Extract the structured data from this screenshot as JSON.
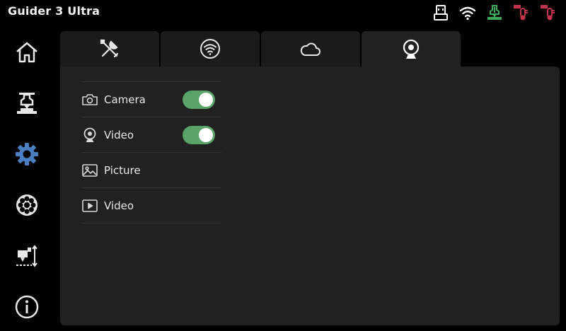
{
  "app": {
    "title": "Guider 3 Ultra"
  },
  "status_bar": {
    "icons": [
      "usb-drive-icon",
      "wifi-icon",
      "nozzle-temperature-icon",
      "bed-temperature-icon",
      "chamber-temperature-icon"
    ]
  },
  "sidebar": {
    "items": [
      {
        "name": "home",
        "icon": "home-icon",
        "active": false
      },
      {
        "name": "print",
        "icon": "printer-nozzle-icon",
        "active": false
      },
      {
        "name": "settings",
        "icon": "gear-icon",
        "active": true
      },
      {
        "name": "filament",
        "icon": "filament-spool-icon",
        "active": false
      },
      {
        "name": "calibration",
        "icon": "leveling-icon",
        "active": false
      },
      {
        "name": "info",
        "icon": "info-icon",
        "active": false
      }
    ]
  },
  "tabs": [
    {
      "name": "tools",
      "icon": "tools-icon",
      "active": false
    },
    {
      "name": "network",
      "icon": "wifi-circle-icon",
      "active": false
    },
    {
      "name": "cloud",
      "icon": "cloud-icon",
      "active": false
    },
    {
      "name": "camera",
      "icon": "webcam-icon",
      "active": true
    }
  ],
  "settings": {
    "rows": [
      {
        "label": "Camera",
        "icon": "camera-icon",
        "toggle": true,
        "on": true
      },
      {
        "label": "Video",
        "icon": "webcam-icon",
        "toggle": true,
        "on": true
      },
      {
        "label": "Picture",
        "icon": "picture-icon",
        "toggle": false
      },
      {
        "label": "Video",
        "icon": "play-icon",
        "toggle": false
      }
    ]
  },
  "colors": {
    "accent": "#4a7fc1",
    "toggle_on": "#5aa469",
    "status_green": "#3fa95f",
    "status_red": "#c2334d",
    "panel": "#212121",
    "tab": "#1b1b1b"
  }
}
